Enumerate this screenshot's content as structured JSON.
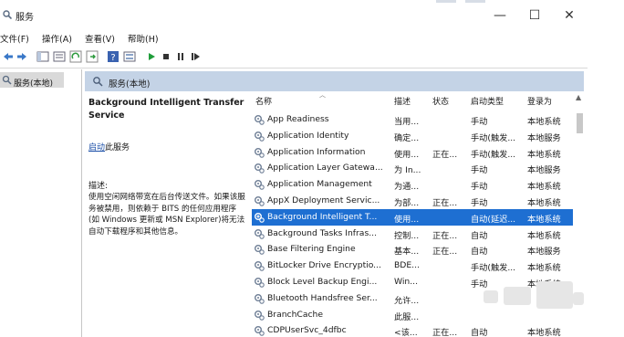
{
  "window": {
    "title": "服务",
    "controls": {
      "minimize": "—",
      "maximize": "☐",
      "close": "✕"
    }
  },
  "menu": [
    "文件(F)",
    "操作(A)",
    "查看(V)",
    "帮助(H)"
  ],
  "toolbar_icons": [
    "back-icon",
    "forward-icon",
    "console-tree-icon",
    "properties-icon",
    "refresh-icon",
    "export-icon",
    "help-icon",
    "view-icon",
    "start-icon",
    "stop-icon",
    "pause-icon",
    "restart-icon"
  ],
  "tree": {
    "item": "服务(本地)"
  },
  "header": {
    "title": "服务(本地)"
  },
  "details": {
    "service_title": "Background Intelligent Transfer Service",
    "start_link_text": "启动",
    "start_link_suffix": "此服务",
    "desc_label": "描述:",
    "desc_text": "使用空闲网络带宽在后台传送文件。如果该服务被禁用，则依赖于 BITS 的任何应用程序(如 Windows 更新或 MSN Explorer)将无法自动下载程序和其他信息。"
  },
  "columns": {
    "name": "名称",
    "desc": "描述",
    "status": "状态",
    "startup": "启动类型",
    "logon": "登录为"
  },
  "services": [
    {
      "name": "App Readiness",
      "desc": "当用...",
      "status": "",
      "startup": "手动",
      "logon": "本地系统"
    },
    {
      "name": "Application Identity",
      "desc": "确定...",
      "status": "",
      "startup": "手动(触发...",
      "logon": "本地服务"
    },
    {
      "name": "Application Information",
      "desc": "使用...",
      "status": "正在...",
      "startup": "手动(触发...",
      "logon": "本地系统"
    },
    {
      "name": "Application Layer Gatewa...",
      "desc": "为 In...",
      "status": "",
      "startup": "手动",
      "logon": "本地服务"
    },
    {
      "name": "Application Management",
      "desc": "为通...",
      "status": "",
      "startup": "手动",
      "logon": "本地系统"
    },
    {
      "name": "AppX Deployment Servic...",
      "desc": "为部...",
      "status": "正在...",
      "startup": "手动",
      "logon": "本地系统"
    },
    {
      "name": "Background Intelligent T...",
      "desc": "使用...",
      "status": "",
      "startup": "自动(延迟...",
      "logon": "本地系统",
      "selected": true
    },
    {
      "name": "Background Tasks Infras...",
      "desc": "控制...",
      "status": "正在...",
      "startup": "自动",
      "logon": "本地系统"
    },
    {
      "name": "Base Filtering Engine",
      "desc": "基本...",
      "status": "正在...",
      "startup": "自动",
      "logon": "本地服务"
    },
    {
      "name": "BitLocker Drive Encryptio...",
      "desc": "BDE...",
      "status": "",
      "startup": "手动(触发...",
      "logon": "本地系统"
    },
    {
      "name": "Block Level Backup Engi...",
      "desc": "Win...",
      "status": "",
      "startup": "手动",
      "logon": "本地系统"
    },
    {
      "name": "Bluetooth Handsfree Ser...",
      "desc": "允许...",
      "status": "",
      "startup": "",
      "logon": ""
    },
    {
      "name": "BranchCache",
      "desc": "此服...",
      "status": "",
      "startup": "",
      "logon": ""
    },
    {
      "name": "CDPUserSvc_4dfbc",
      "desc": "<该...",
      "status": "正在...",
      "startup": "自动",
      "logon": "本地系统"
    }
  ],
  "colors": {
    "selection": "#1e6fd2",
    "header_band": "#c4d3e6",
    "link": "#1b4fa8",
    "play_green": "#1f9d3a"
  }
}
